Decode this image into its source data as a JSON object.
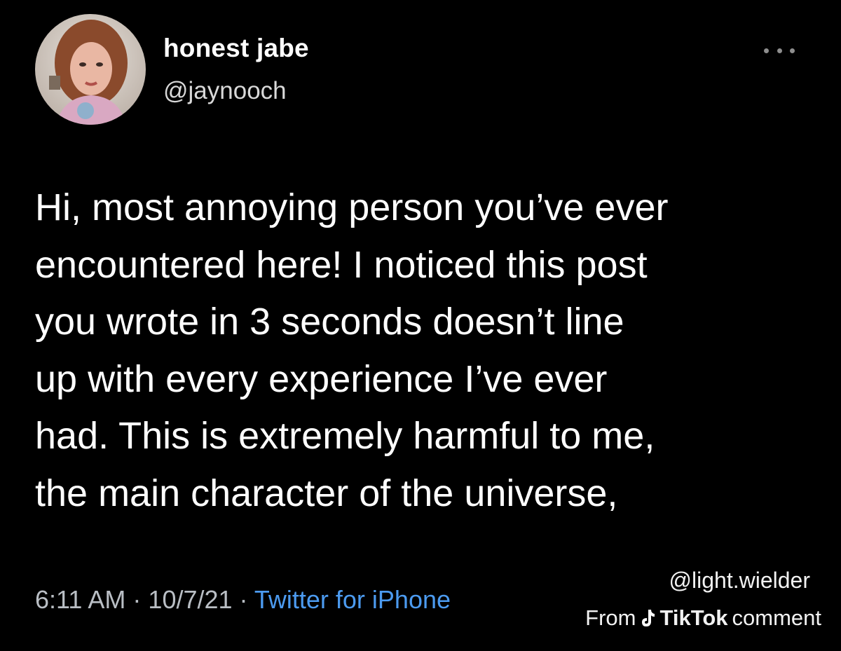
{
  "tweet": {
    "author": {
      "display_name": "honest jabe",
      "handle": "@jaynooch",
      "avatar_icon": "profile-photo"
    },
    "more_icon": "ellipsis-icon",
    "text_lines": [
      "Hi, most annoying person you’ve ever",
      "encountered here! I noticed this post",
      "you wrote in 3 seconds doesn’t line",
      "up with every experience I’ve ever",
      "had. This is extremely harmful to me,",
      "the main character of the universe,"
    ],
    "meta": {
      "time": "6:11 AM",
      "separator": " · ",
      "date": "10/7/21",
      "source": "Twitter for iPhone"
    }
  },
  "watermark": {
    "username": "@light.wielder",
    "prefix": "From",
    "platform": "TikTok",
    "suffix": "comment",
    "platform_icon": "tiktok-logo-icon"
  },
  "colors": {
    "background": "#000000",
    "text": "#ffffff",
    "meta_text": "#b9bec4",
    "link": "#4c9bf0"
  }
}
